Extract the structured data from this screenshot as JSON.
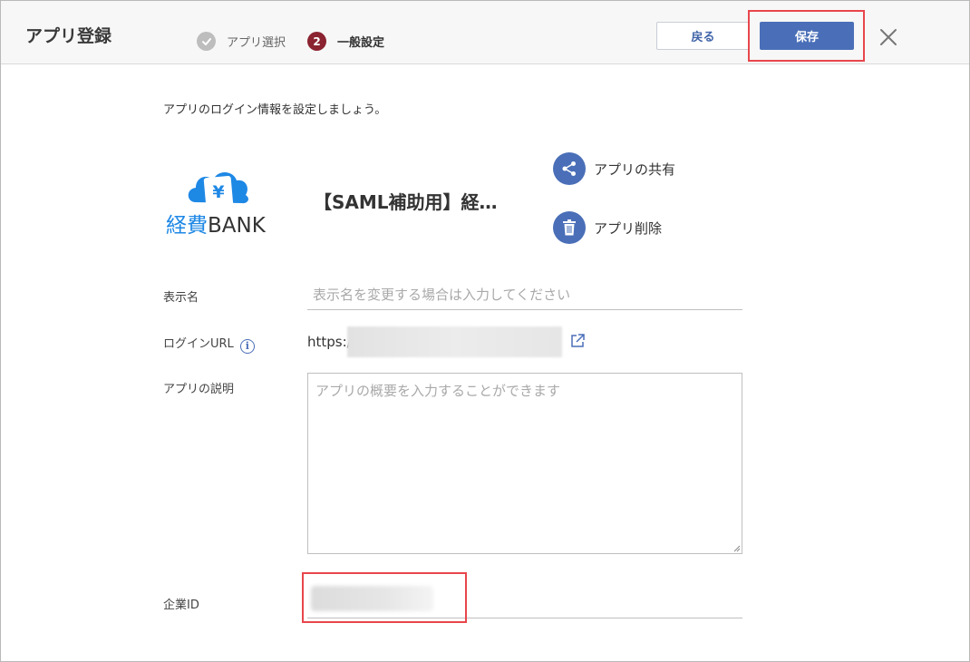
{
  "header": {
    "title": "アプリ登録",
    "steps": [
      {
        "number": "",
        "label": "アプリ選択",
        "state": "done"
      },
      {
        "number": "2",
        "label": "一般設定",
        "state": "current"
      }
    ],
    "back_label": "戻る",
    "save_label": "保存"
  },
  "main": {
    "intro": "アプリのログイン情報を設定しましょう。",
    "logo_text": "経費BANK",
    "app_name": "【SAML補助用】経…",
    "actions": {
      "share_label": "アプリの共有",
      "delete_label": "アプリ削除"
    },
    "form": {
      "display_name": {
        "label": "表示名",
        "placeholder": "表示名を変更する場合は入力してください"
      },
      "login_url": {
        "label": "ログインURL",
        "value_prefix": "https:/"
      },
      "description": {
        "label": "アプリの説明",
        "placeholder": "アプリの概要を入力することができます"
      },
      "company_id": {
        "label": "企業ID"
      }
    }
  },
  "colors": {
    "accent": "#4a6fb8",
    "step_current": "#8b2330",
    "highlight": "#e8464c",
    "logo_blue": "#1e88e5"
  },
  "icons": [
    "check-icon",
    "close-icon",
    "share-icon",
    "trash-icon",
    "info-icon",
    "external-link-icon",
    "cloud-yen-icon"
  ]
}
